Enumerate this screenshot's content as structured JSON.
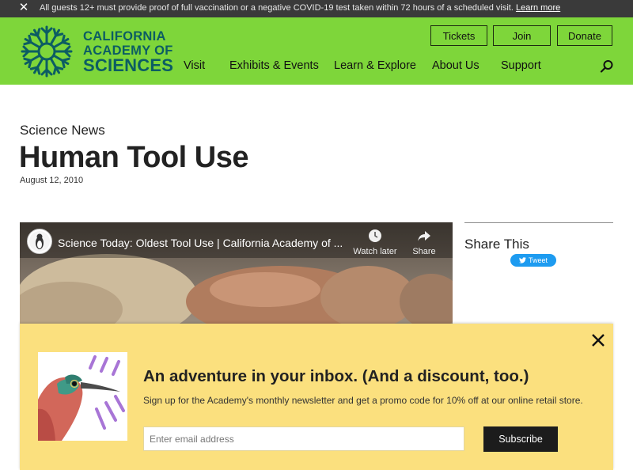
{
  "alert": {
    "message": "All guests 12+ must provide proof of full vaccination or a negative COVID-19 test taken within 72 hours of a scheduled visit.",
    "link_text": "Learn more"
  },
  "brand": {
    "line1": "CALIFORNIA",
    "line2": "ACADEMY OF",
    "line3": "SCIENCES"
  },
  "top_buttons": [
    "Tickets",
    "Join",
    "Donate"
  ],
  "nav": [
    "Visit",
    "Exhibits & Events",
    "Learn & Explore",
    "About Us",
    "Support"
  ],
  "article": {
    "kicker": "Science News",
    "title": "Human Tool Use",
    "date": "August 12, 2010"
  },
  "video": {
    "title": "Science Today: Oldest Tool Use | California Academy of ...",
    "watch_later": "Watch later",
    "share": "Share"
  },
  "share": {
    "title": "Share This",
    "tweet": "Tweet"
  },
  "newsletter": {
    "heading": "An adventure in your inbox. (And a discount, too.)",
    "subtext": "Sign up for the Academy's monthly newsletter and get a promo code for 10% off at our online retail store.",
    "email_placeholder": "Enter email address",
    "subscribe": "Subscribe"
  },
  "colors": {
    "header_green": "#7ed63a",
    "brand_teal": "#0c5d63",
    "newsletter_yellow": "#fbe07e",
    "alert_bar": "#3a3a3a",
    "tweet_blue": "#1d9bf0"
  }
}
